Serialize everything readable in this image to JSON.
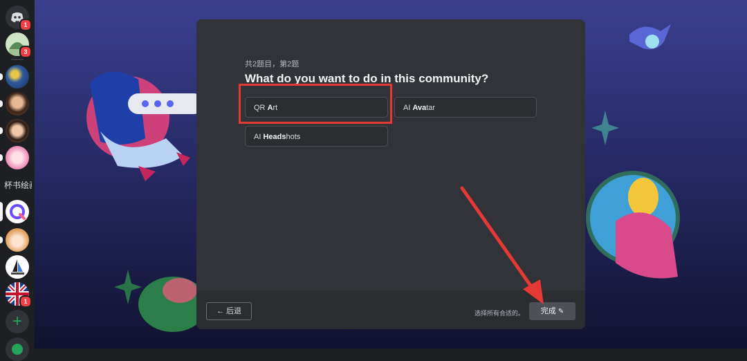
{
  "modal": {
    "progress": "共2题目，第2题",
    "question": "What do you want to do in this community?",
    "options": [
      {
        "prefix": "QR ",
        "strong": "A",
        "suffix": "rt"
      },
      {
        "prefix": "AI ",
        "strong": "Ava",
        "suffix": "tar"
      },
      {
        "prefix": "AI ",
        "strong": "Heads",
        "suffix": "hots"
      }
    ],
    "footer": {
      "back_label": "后退",
      "hint": "选择所有合适的。",
      "done_label": "完成"
    }
  },
  "sidebar": {
    "badges": {
      "home": "1",
      "server_1": "3",
      "server_11": "1"
    },
    "text_server": "杯书绘画"
  },
  "colors": {
    "modal_bg": "#313338",
    "footer_bg": "#2b2d31",
    "annotation_red": "#e53935",
    "add_green": "#23a559"
  }
}
